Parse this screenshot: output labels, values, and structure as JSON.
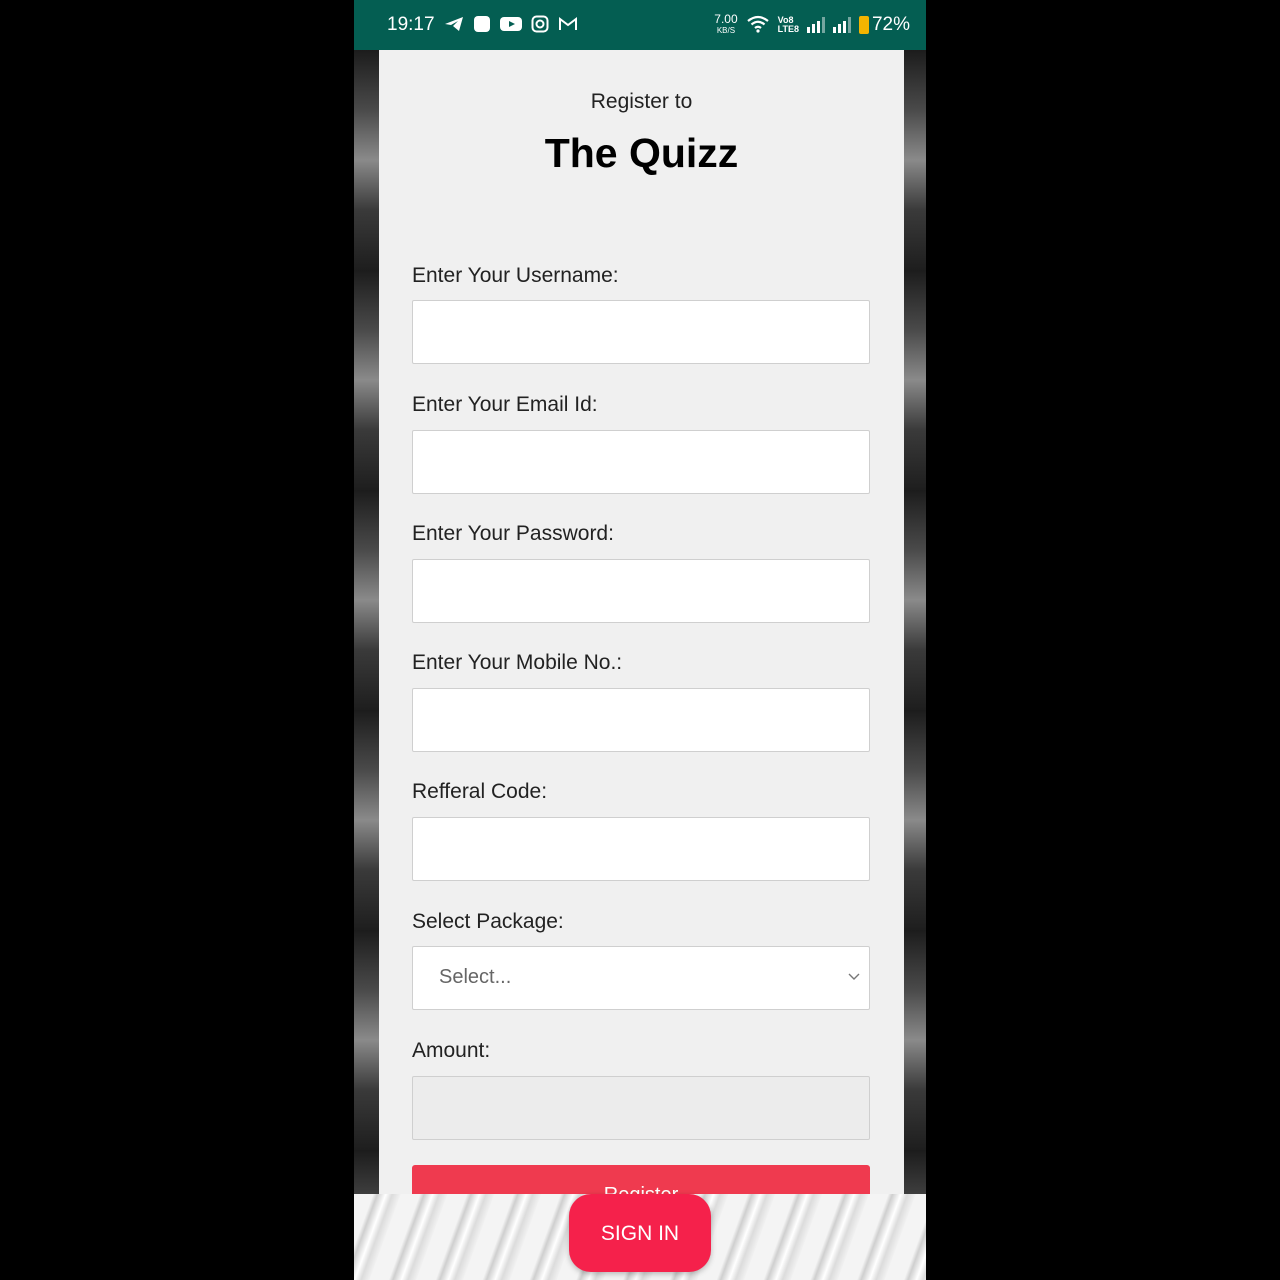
{
  "status_bar": {
    "time": "19:17",
    "net_speed_value": "7.00",
    "net_speed_unit": "KB/S",
    "volte_top": "Vo8",
    "volte_bottom": "LTE8",
    "battery": "72%",
    "icons": [
      "telegram-icon",
      "app-icon",
      "youtube-icon",
      "instagram-icon",
      "gmail-icon",
      "wifi-icon",
      "signal-icon",
      "signal-icon",
      "battery-icon"
    ]
  },
  "form": {
    "subtitle": "Register to",
    "title": "The Quizz",
    "fields": [
      {
        "label": "Enter Your Username:",
        "value": ""
      },
      {
        "label": "Enter Your Email Id:",
        "value": ""
      },
      {
        "label": "Enter Your Password:",
        "value": ""
      },
      {
        "label": "Enter Your Mobile No.:",
        "value": ""
      },
      {
        "label": "Refferal Code:",
        "value": ""
      }
    ],
    "package": {
      "label": "Select Package:",
      "selected": "Select..."
    },
    "amount": {
      "label": "Amount:",
      "value": ""
    },
    "register_label": "Register"
  },
  "signin_label": "SIGN IN",
  "colors": {
    "status_bar": "#045e52",
    "register_button": "#ef3a4f",
    "signin_button": "#f5214b",
    "battery": "#f3b400"
  }
}
